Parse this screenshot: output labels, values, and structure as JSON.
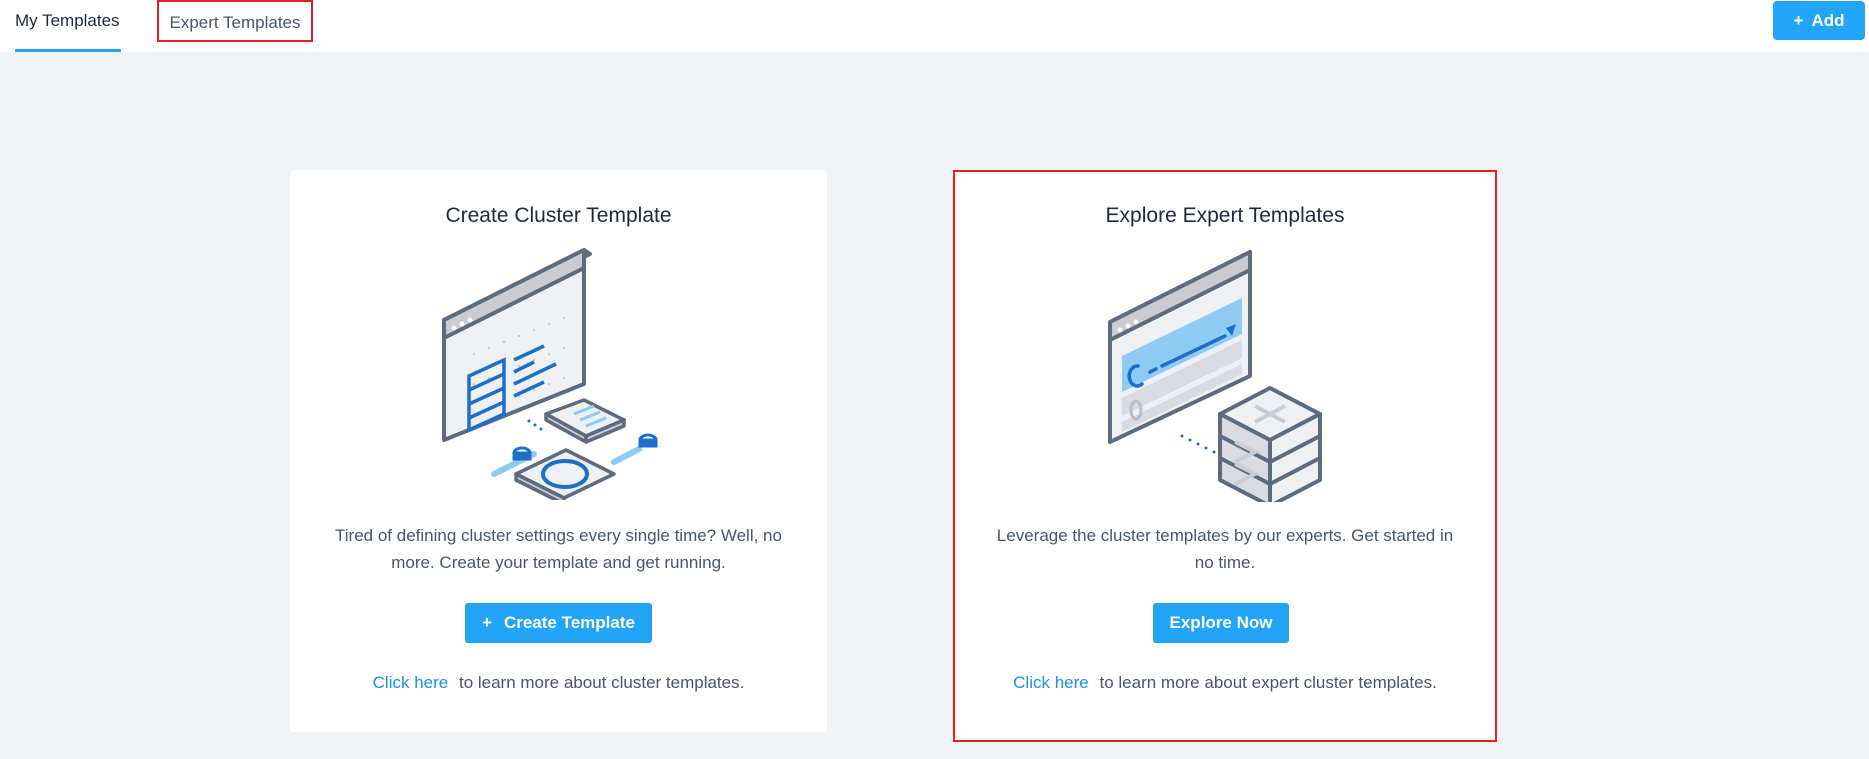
{
  "tabs": {
    "my_templates": "My Templates",
    "expert_templates": "Expert Templates"
  },
  "header": {
    "add_icon": "+",
    "add_label": "Add"
  },
  "create_card": {
    "title": "Create Cluster Template",
    "description": "Tired of defining cluster settings every single time? Well, no more. Create your template and get running.",
    "button_icon": "+",
    "button_label": "Create Template",
    "link_text": "Click here",
    "link_suffix": "to learn more about cluster templates.",
    "illustration_icon": "cluster-template-illustration"
  },
  "explore_card": {
    "title": "Explore Expert Templates",
    "description": "Leverage the cluster templates by our experts. Get started in no time.",
    "button_label": "Explore Now",
    "link_text": "Click here",
    "link_suffix": "to learn more about expert cluster templates.",
    "illustration_icon": "expert-template-illustration"
  },
  "colors": {
    "accent": "#22a5f7",
    "link": "#1e8fe1",
    "highlight_border": "#e51d24",
    "background": "#f2f3f5"
  }
}
